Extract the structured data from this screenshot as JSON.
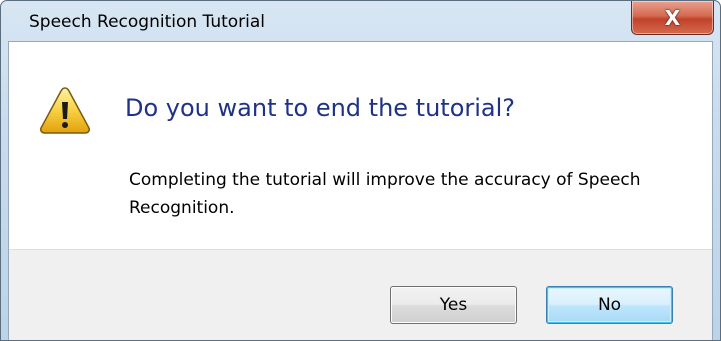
{
  "window": {
    "title": "Speech Recognition Tutorial",
    "close_glyph": "X"
  },
  "dialog": {
    "icon": "warning-icon",
    "main_instruction": "Do you want to end the tutorial?",
    "content": "Completing the tutorial will improve the accuracy of Speech Recognition."
  },
  "buttons": {
    "yes_label": "Yes",
    "no_label": "No"
  },
  "colors": {
    "main_instruction": "#1e3287",
    "close_button": "#c0432a",
    "default_button_border": "#3c7fb1",
    "warning_fill": "#f4c430"
  }
}
